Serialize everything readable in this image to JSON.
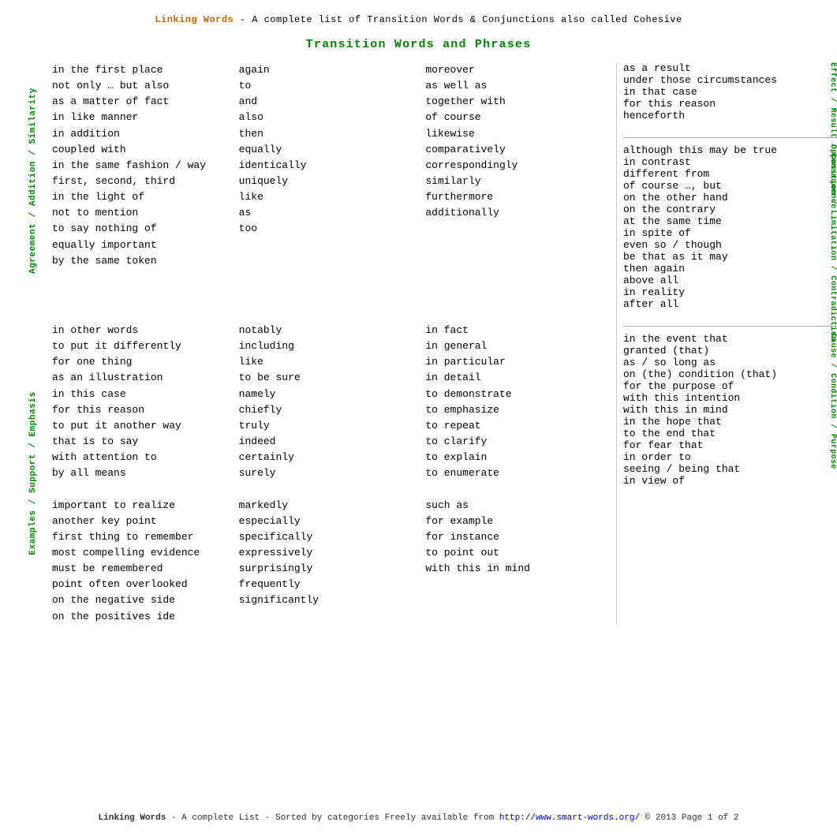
{
  "header": {
    "title": "Linking Words",
    "subtitle": " - A complete list of Transition Words & Conjunctions also called Cohesive"
  },
  "section_title": "Transition Words and Phrases",
  "agreement_label": "Agreement / Addition / Similarity",
  "examples_label": "Examples / Support / Emphasis",
  "agreement_col1": [
    "in the first place",
    "not only … but also",
    "as a matter of fact",
    "in like manner",
    "in addition",
    "coupled with",
    "in the same fashion / way",
    "first, second, third",
    "in the light of",
    "not to mention",
    "to say nothing of",
    "equally important",
    "by the same token"
  ],
  "agreement_col2": [
    "again",
    "to",
    "and",
    "also",
    "then",
    "equally",
    "identically",
    "uniquely",
    "like",
    "as",
    "too"
  ],
  "agreement_col3": [
    "moreover",
    "as well as",
    "together with",
    "of course",
    "likewise",
    "comparatively",
    "correspondingly",
    "similarly",
    "furthermore",
    "additionally"
  ],
  "examples_col1": [
    "in other words",
    "to put it differently",
    "for one thing",
    "as an illustration",
    "in this case",
    "for this reason",
    "to put it another way",
    "that is to say",
    "with attention to",
    "by all means",
    "",
    "important to realize",
    "another key point",
    "first thing to remember",
    "most compelling evidence",
    "must be remembered",
    "point often overlooked",
    "on the negative side",
    "on the positives ide"
  ],
  "examples_col2": [
    "notably",
    "including",
    "like",
    "to be sure",
    "namely",
    "chiefly",
    "truly",
    "indeed",
    "certainly",
    "surely",
    "",
    "markedly",
    "especially",
    "specifically",
    "expressively",
    "surprisingly",
    "frequently",
    "significantly"
  ],
  "examples_col3": [
    "in fact",
    "in general",
    "in particular",
    "in detail",
    "to demonstrate",
    "to emphasize",
    "to repeat",
    "to clarify",
    "to explain",
    "to enumerate",
    "",
    "such as",
    "for example",
    "for instance",
    "to point out",
    "with this in mind"
  ],
  "right_effect_label": "Effect / Result / Consequence",
  "right_effect_words": [
    "as a result",
    "under those circumstances",
    "in that case",
    "for this reason",
    "henceforth"
  ],
  "right_opposition_label": "Opposition / Limitation / Contradiction",
  "right_opposition_words": [
    "although this may be true",
    "in contrast",
    "different from",
    "of course …, but",
    "on the other hand",
    "on the contrary",
    "at the same time",
    "in spite of",
    "even so / though",
    "be that as it may",
    "then again",
    "above all",
    "in reality",
    "after all"
  ],
  "right_cause_label": "Cause / Condition / Purpose",
  "right_cause_words": [
    "in the event that",
    "granted (that)",
    "as / so long as",
    "on (the) condition (that)",
    "for the purpose of",
    "with this intention",
    "with this in mind",
    "in the hope that",
    "to the end that",
    "for fear that",
    "in order to",
    "seeing / being that",
    "in view of"
  ],
  "footer": {
    "title": "Linking Words",
    "text1": " - A complete List - Sorted by categories",
    "text2": "   Freely available from  ",
    "url": "http://www.smart-words.org/",
    "text3": "   © 2013   Page 1 of 2"
  }
}
